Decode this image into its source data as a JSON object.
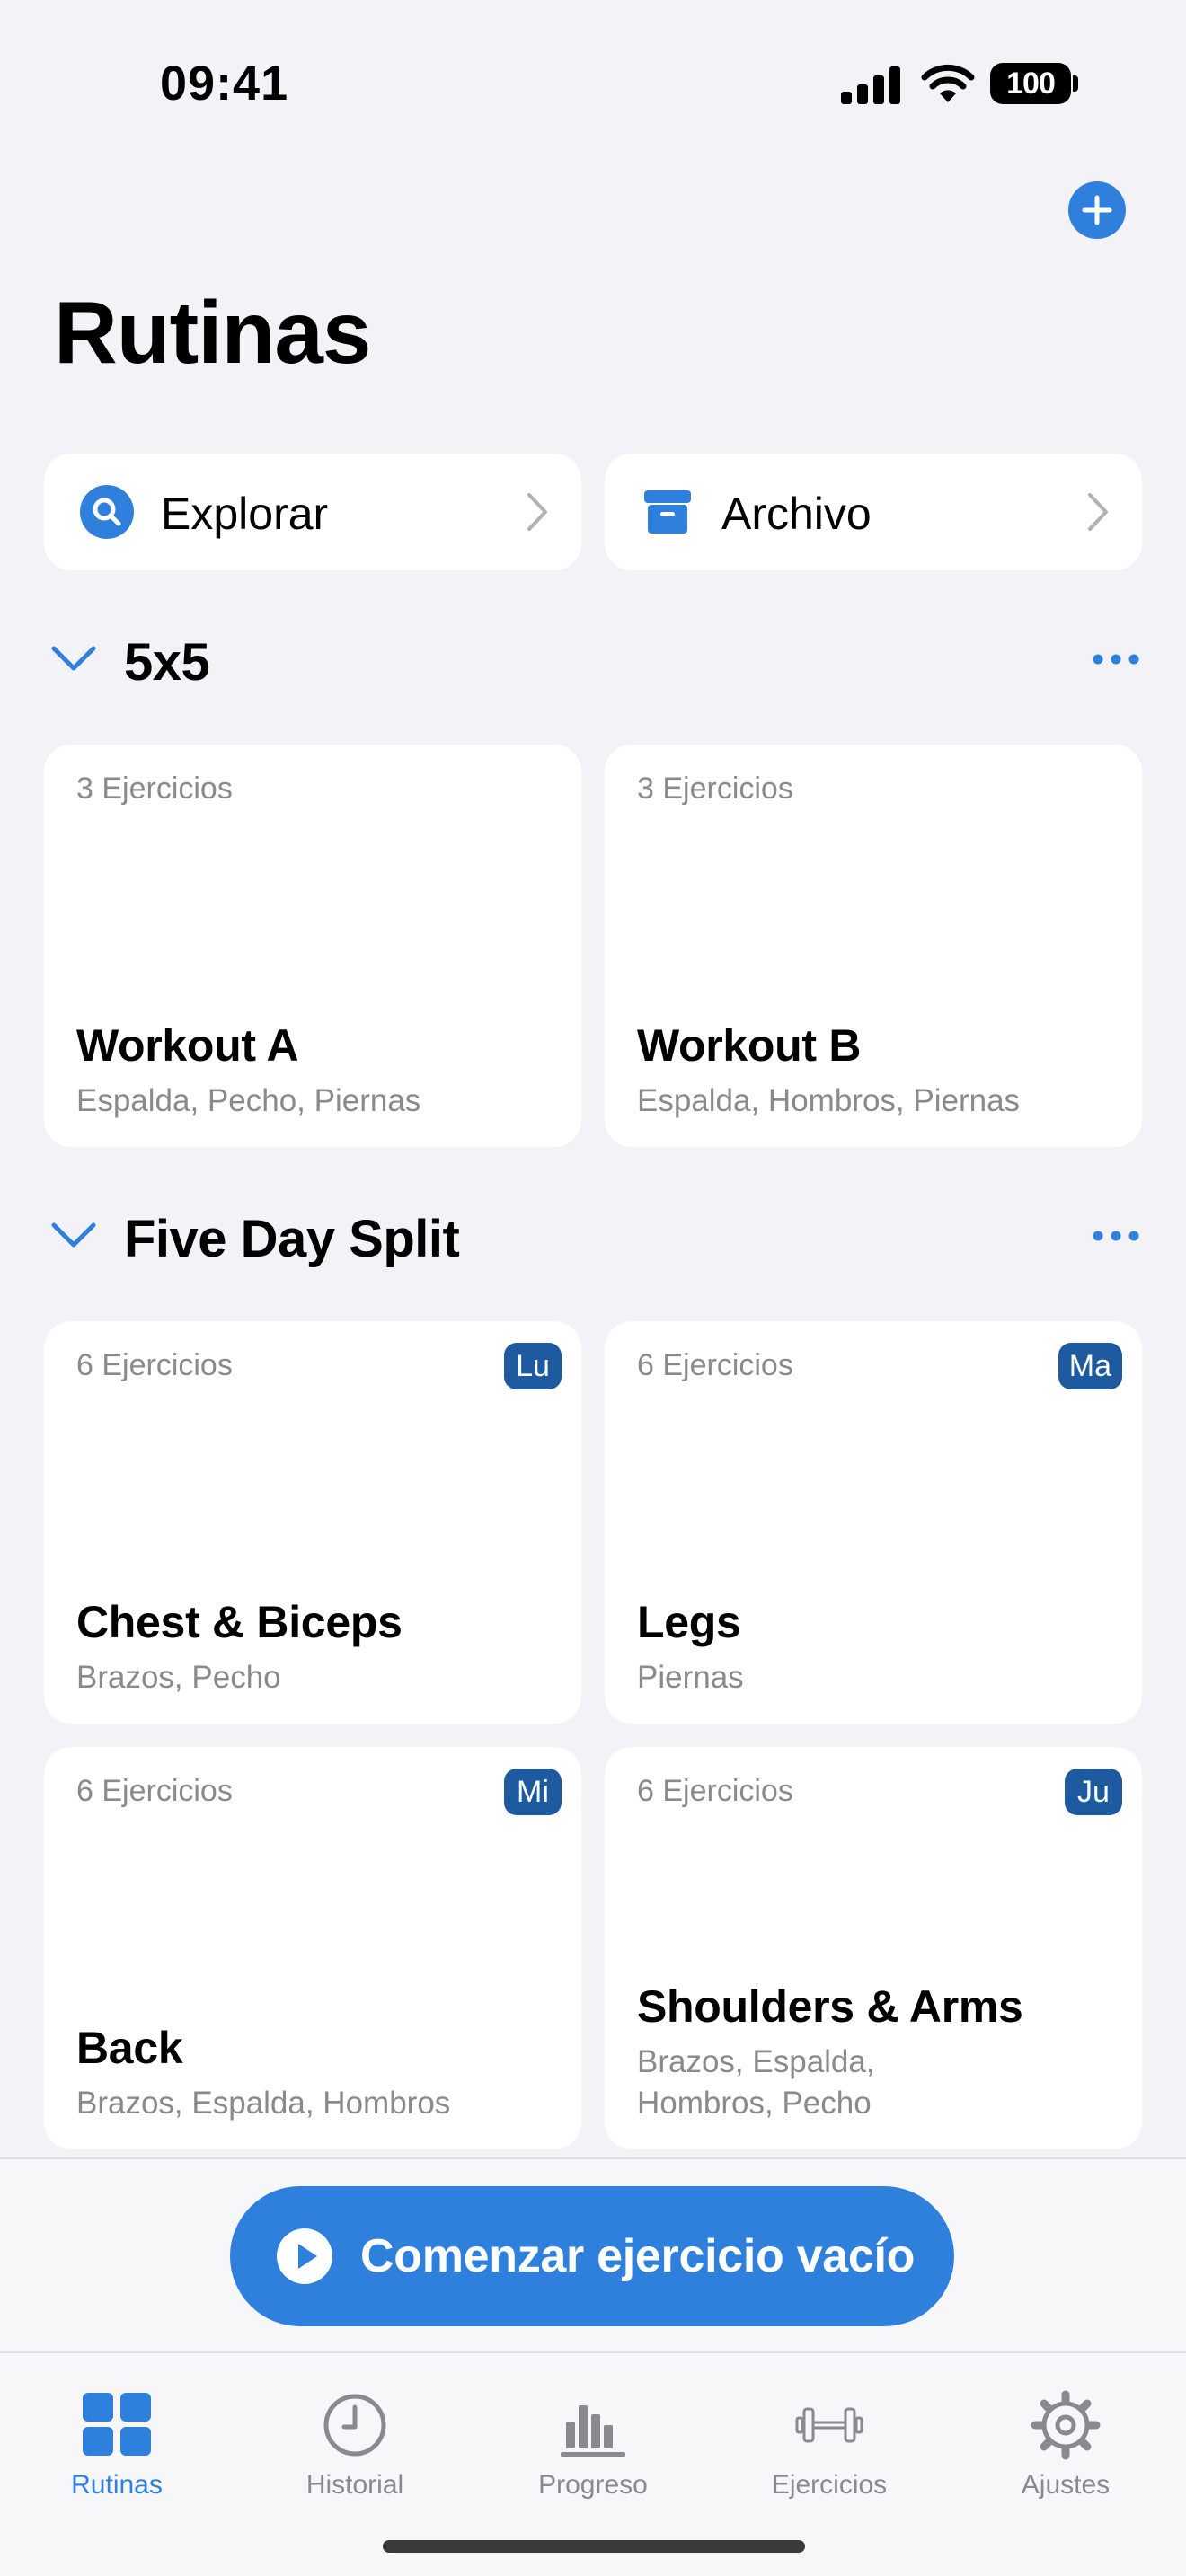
{
  "status_bar": {
    "time": "09:41",
    "battery": "100"
  },
  "header": {
    "title": "Rutinas"
  },
  "quick_links": [
    {
      "label": "Explorar",
      "icon": "search-icon"
    },
    {
      "label": "Archivo",
      "icon": "archive-box-icon"
    }
  ],
  "sections": [
    {
      "title": "5x5",
      "cards": [
        {
          "count": "3 Ejercicios",
          "name": "Workout A",
          "muscles": "Espalda, Pecho, Piernas"
        },
        {
          "count": "3 Ejercicios",
          "name": "Workout B",
          "muscles": "Espalda, Hombros, Piernas"
        }
      ]
    },
    {
      "title": "Five Day Split",
      "cards": [
        {
          "count": "6 Ejercicios",
          "day": "Lu",
          "name": "Chest & Biceps",
          "muscles": "Brazos, Pecho"
        },
        {
          "count": "6 Ejercicios",
          "day": "Ma",
          "name": "Legs",
          "muscles": "Piernas"
        },
        {
          "count": "6 Ejercicios",
          "day": "Mi",
          "name": "Back",
          "muscles": "Brazos, Espalda, Hombros"
        },
        {
          "count": "6 Ejercicios",
          "day": "Ju",
          "name": "Shoulders & Arms",
          "muscles": "Brazos, Espalda, Hombros, Pecho"
        }
      ]
    }
  ],
  "start_button": {
    "label": "Comenzar ejercicio vacío"
  },
  "tabs": [
    {
      "label": "Rutinas",
      "icon": "grid-icon",
      "active": true
    },
    {
      "label": "Historial",
      "icon": "clock-icon",
      "active": false
    },
    {
      "label": "Progreso",
      "icon": "bar-chart-icon",
      "active": false
    },
    {
      "label": "Ejercicios",
      "icon": "dumbbell-icon",
      "active": false
    },
    {
      "label": "Ajustes",
      "icon": "gear-icon",
      "active": false
    }
  ],
  "colors": {
    "accent": "#2f80dd",
    "day_badge": "#1e5aa0",
    "background": "#f2f2f7"
  }
}
